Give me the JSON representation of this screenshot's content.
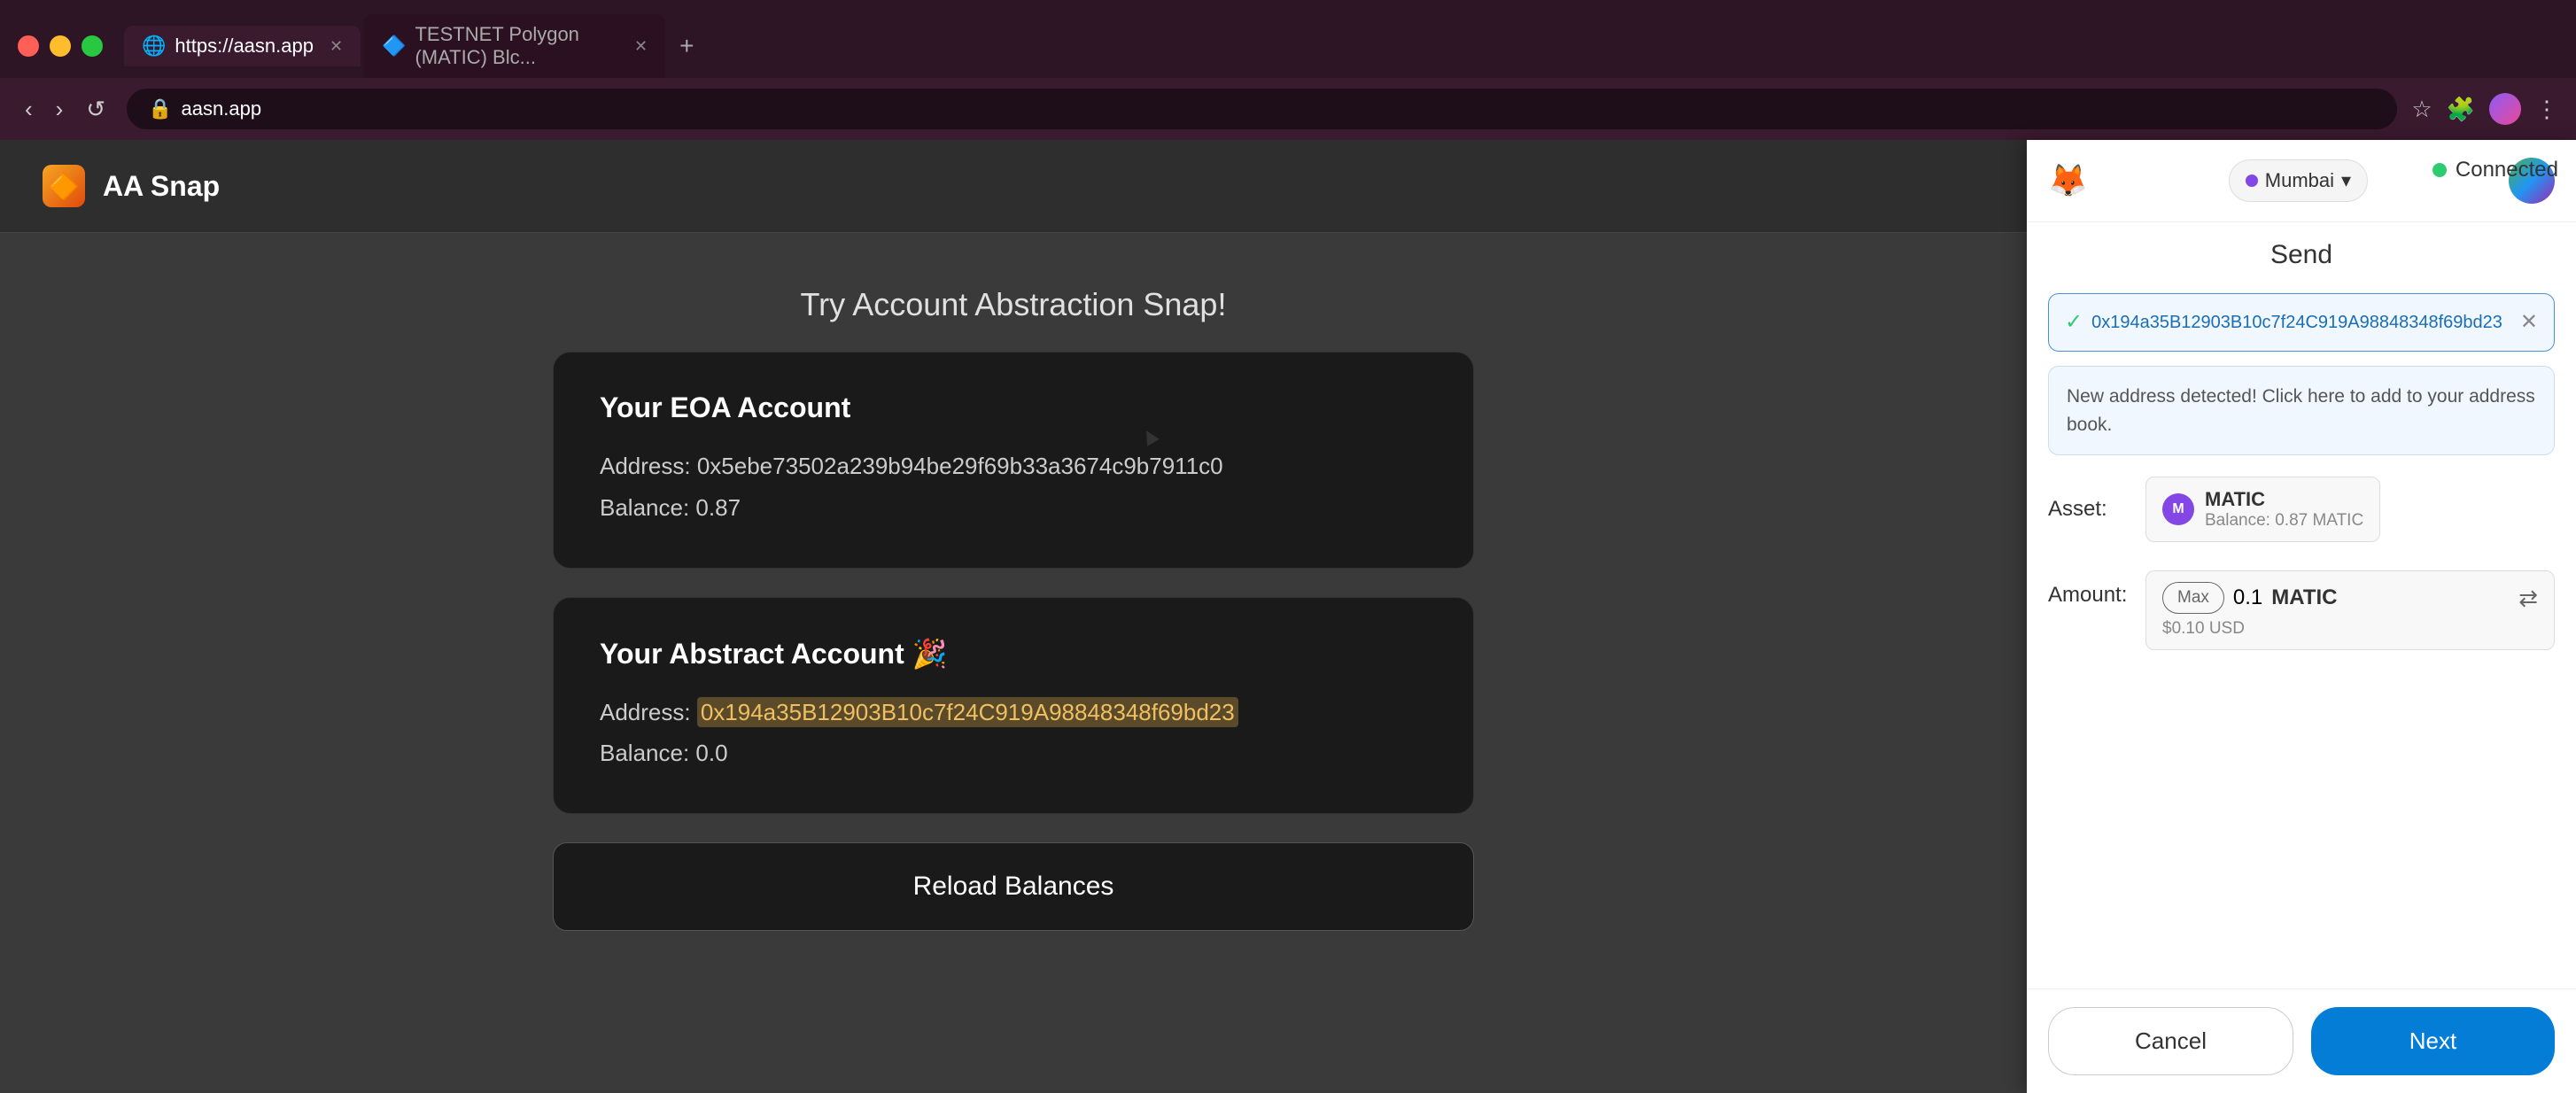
{
  "browser": {
    "tabs": [
      {
        "id": "tab1",
        "favicon": "🌐",
        "label": "https://aasn.app",
        "active": true
      },
      {
        "id": "tab2",
        "favicon": "🔷",
        "label": "TESTNET Polygon (MATIC) Blc...",
        "active": false
      }
    ],
    "address": "aasn.app",
    "nav": {
      "back": "‹",
      "forward": "›",
      "reload": "↺"
    }
  },
  "app": {
    "logo": "🔶",
    "title": "AA Snap",
    "page_title": "Try Account Abstraction Snap!",
    "eoa_card": {
      "title": "Your EOA Account",
      "address_label": "Address:",
      "address": "0x5ebe73502a239b94be29f69b33a3674c9b7911c0",
      "balance_label": "Balance:",
      "balance": "0.87"
    },
    "abstract_card": {
      "title": "Your Abstract Account 🎉",
      "address_label": "Address:",
      "address": "0x194a35B12903B10c7f24C919A98848348f69bd23",
      "balance_label": "Balance:",
      "balance": "0.0"
    },
    "reload_button": "Reload Balances"
  },
  "metamask": {
    "logo": "🦊",
    "network": {
      "label": "Mumbai",
      "icon": "●"
    },
    "title": "Send",
    "address_chip": {
      "address": "0x194a35B12903B10c7f24C919A98848348f69bd23",
      "check": "✓",
      "close": "✕"
    },
    "notice": "New address detected! Click here to add to your address book.",
    "asset": {
      "label": "Asset:",
      "name": "MATIC",
      "balance": "Balance: 0.87 MATIC"
    },
    "amount": {
      "label": "Amount:",
      "value": "0.1",
      "currency": "MATIC",
      "usd": "$0.10 USD",
      "max_button": "Max"
    },
    "cancel_button": "Cancel",
    "next_button": "Next",
    "connected": "Connected"
  }
}
